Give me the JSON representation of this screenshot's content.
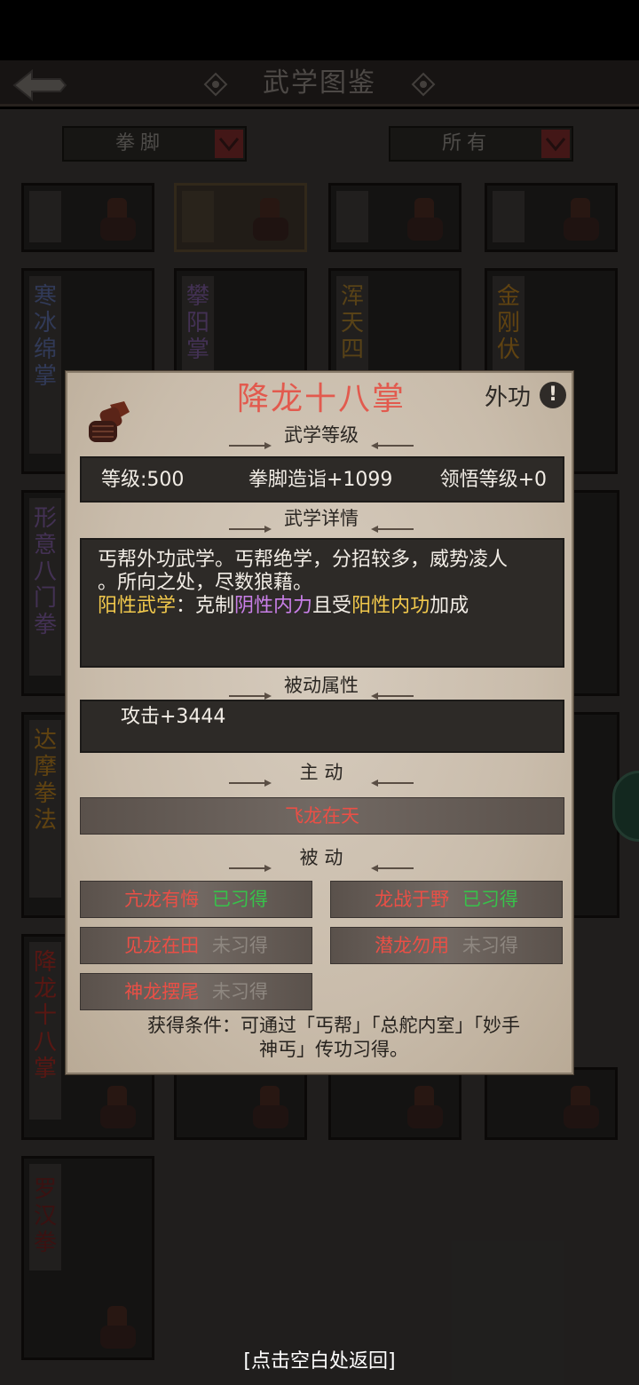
{
  "header": {
    "title": "武学图鉴"
  },
  "filters": {
    "category": "拳脚",
    "scope": "所有"
  },
  "background_cards": [
    {
      "name": ""
    },
    {
      "name": ""
    },
    {
      "name": ""
    },
    {
      "name": ""
    },
    {
      "name": "寒冰绵掌"
    },
    {
      "name": "攀阳掌"
    },
    {
      "name": "浑天四"
    },
    {
      "name": "金刚伏"
    },
    {
      "name": "形意八门拳"
    },
    {
      "name": "达摩拳法"
    },
    {
      "name": "降龙十八掌"
    },
    {
      "name": "罗汉拳"
    }
  ],
  "colors": {
    "title_red": "#e25a4e",
    "learned_green": "#37c24a",
    "yang_gold": "#f2c94c",
    "yin_purple": "#c97fe8",
    "dialog_paper": "#d2c6b7"
  },
  "dialog": {
    "icon": "fist-icon",
    "title": "降龙十八掌",
    "type": "外功",
    "info_icon": "!",
    "level_section": "武学等级",
    "level": "等级:500",
    "skill_bonus": "拳脚造诣+1099",
    "insight": "领悟等级+0",
    "detail_section": "武学详情",
    "detail_line1": "丐帮外功武学。丐帮绝学，分招较多，威势凌人",
    "detail_line2": "。所向之处，尽数狼藉。",
    "yang_label": "阳性武学",
    "yang_sep": "：克制",
    "yin_power": "阴性内力",
    "yin_mid": "且受",
    "yang_power": "阳性内功",
    "bonus_suffix": "加成",
    "passive_attr_section": "被动属性",
    "passive_attr": "攻击+3444",
    "active_section": "主 动",
    "active_skill": "飞龙在天",
    "passive_section": "被 动",
    "passives": [
      {
        "name": "亢龙有悔",
        "status": "已习得"
      },
      {
        "name": "龙战于野",
        "status": "已习得"
      },
      {
        "name": "见龙在田",
        "status": "未习得"
      },
      {
        "name": "潜龙勿用",
        "status": "未习得"
      },
      {
        "name": "神龙摆尾",
        "status": "未习得"
      }
    ],
    "condition_line1": "获得条件：可通过「丐帮」「总舵内室」「妙手",
    "condition_line2": "神丐」传功习得。"
  },
  "footer_hint": "[点击空白处返回]"
}
